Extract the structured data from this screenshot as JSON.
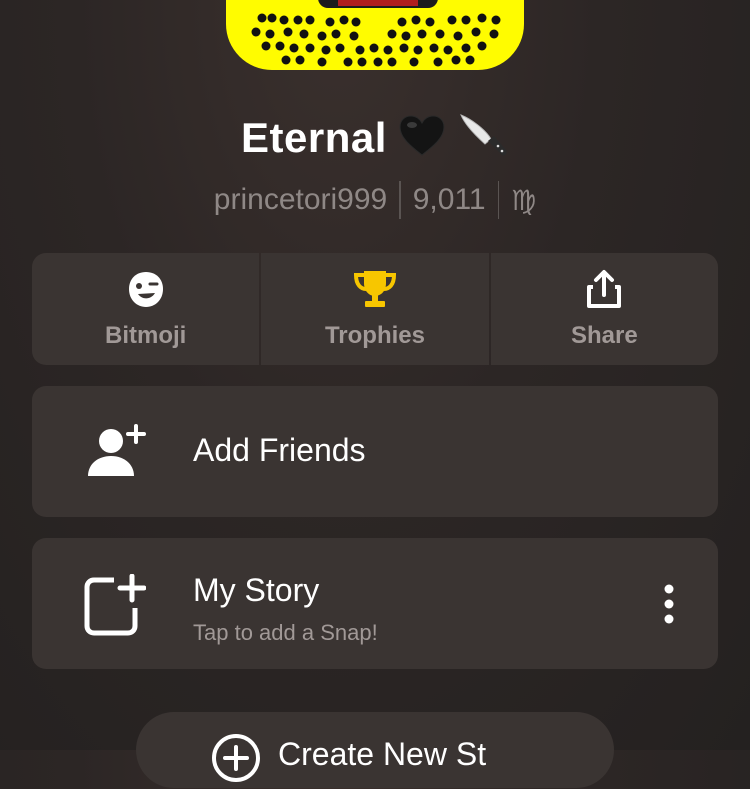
{
  "profile": {
    "display_name": "Eternal",
    "username": "princetori999",
    "score": "9,011",
    "zodiac_symbol": "♍"
  },
  "actions": [
    {
      "label": "Bitmoji",
      "icon": "bitmoji-face-icon"
    },
    {
      "label": "Trophies",
      "icon": "trophy-icon"
    },
    {
      "label": "Share",
      "icon": "share-icon"
    }
  ],
  "add_friends": {
    "label": "Add Friends",
    "icon": "add-friend-icon"
  },
  "my_story": {
    "title": "My Story",
    "subtitle": "Tap to add a Snap!",
    "icon": "add-story-icon"
  },
  "create_story": {
    "label": "Create New St",
    "icon": "plus-circle-icon"
  },
  "colors": {
    "snapcode_yellow": "#fffc00",
    "trophy_gold": "#f7c600",
    "card_bg": "#3a3432",
    "muted_text": "#a19997"
  }
}
